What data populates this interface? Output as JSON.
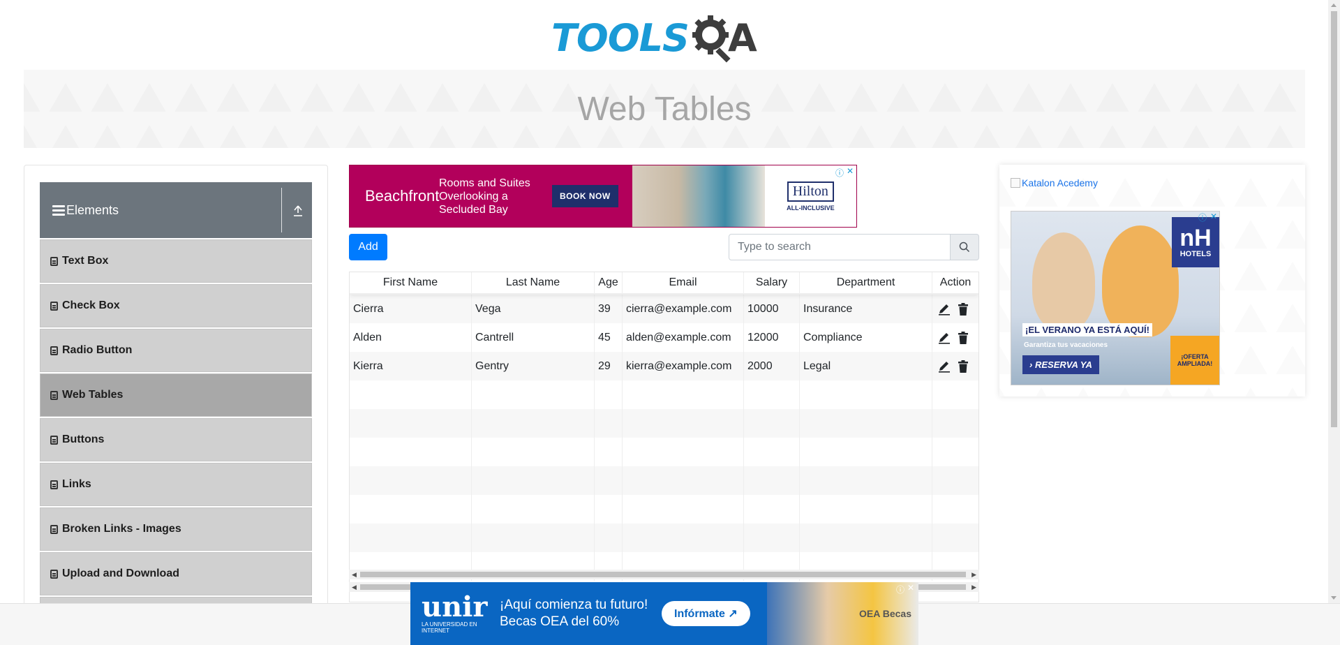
{
  "logo": {
    "tools": "TOOLS",
    "a": "A"
  },
  "page_title": "Web Tables",
  "sidebar": {
    "group_title": "Elements",
    "items": [
      {
        "label": "Text Box"
      },
      {
        "label": "Check Box"
      },
      {
        "label": "Radio Button"
      },
      {
        "label": "Web Tables",
        "active": true
      },
      {
        "label": "Buttons"
      },
      {
        "label": "Links"
      },
      {
        "label": "Broken Links - Images"
      },
      {
        "label": "Upload and Download"
      }
    ]
  },
  "ad_top": {
    "brand": "Beachfront",
    "description": "Rooms and Suites Overlooking a Secluded Bay",
    "cta": "BOOK NOW",
    "logo": "Hilton",
    "logo_sub": "ALL-INCLUSIVE"
  },
  "controls": {
    "add_label": "Add",
    "search_placeholder": "Type to search"
  },
  "table": {
    "columns": [
      "First Name",
      "Last Name",
      "Age",
      "Email",
      "Salary",
      "Department",
      "Action"
    ],
    "rows": [
      {
        "first": "Cierra",
        "last": "Vega",
        "age": "39",
        "email": "cierra@example.com",
        "salary": "10000",
        "department": "Insurance"
      },
      {
        "first": "Alden",
        "last": "Cantrell",
        "age": "45",
        "email": "alden@example.com",
        "salary": "12000",
        "department": "Compliance"
      },
      {
        "first": "Kierra",
        "last": "Gentry",
        "age": "29",
        "email": "kierra@example.com",
        "salary": "2000",
        "department": "Legal"
      }
    ],
    "empty_rows": 7
  },
  "right_ad": {
    "image_alt": "Katalon Acedemy",
    "nh_logo": "nH",
    "nh_logo_sub": "HOTELS",
    "headline": "¡EL VERANO YA ESTÁ AQUÍ!",
    "subline": "Garantiza tus vacaciones",
    "cta": "RESERVA YA",
    "offer": "¡OFERTA AMPLIADA!"
  },
  "ad_bottom": {
    "brand": "unir",
    "brand_sub": "LA UNIVERSIDAD EN INTERNET",
    "headline": "¡Aquí comienza tu futuro!",
    "subline": "Becas OEA del 60%",
    "cta": "Infórmate ↗",
    "partner": "OEA Becas"
  },
  "colors": {
    "accent": "#007bff",
    "sidebar_header": "#6c757d",
    "menu_item": "#d0d0d0",
    "menu_item_active": "#a8a8a8",
    "logo_blue": "#1a9ad6"
  }
}
